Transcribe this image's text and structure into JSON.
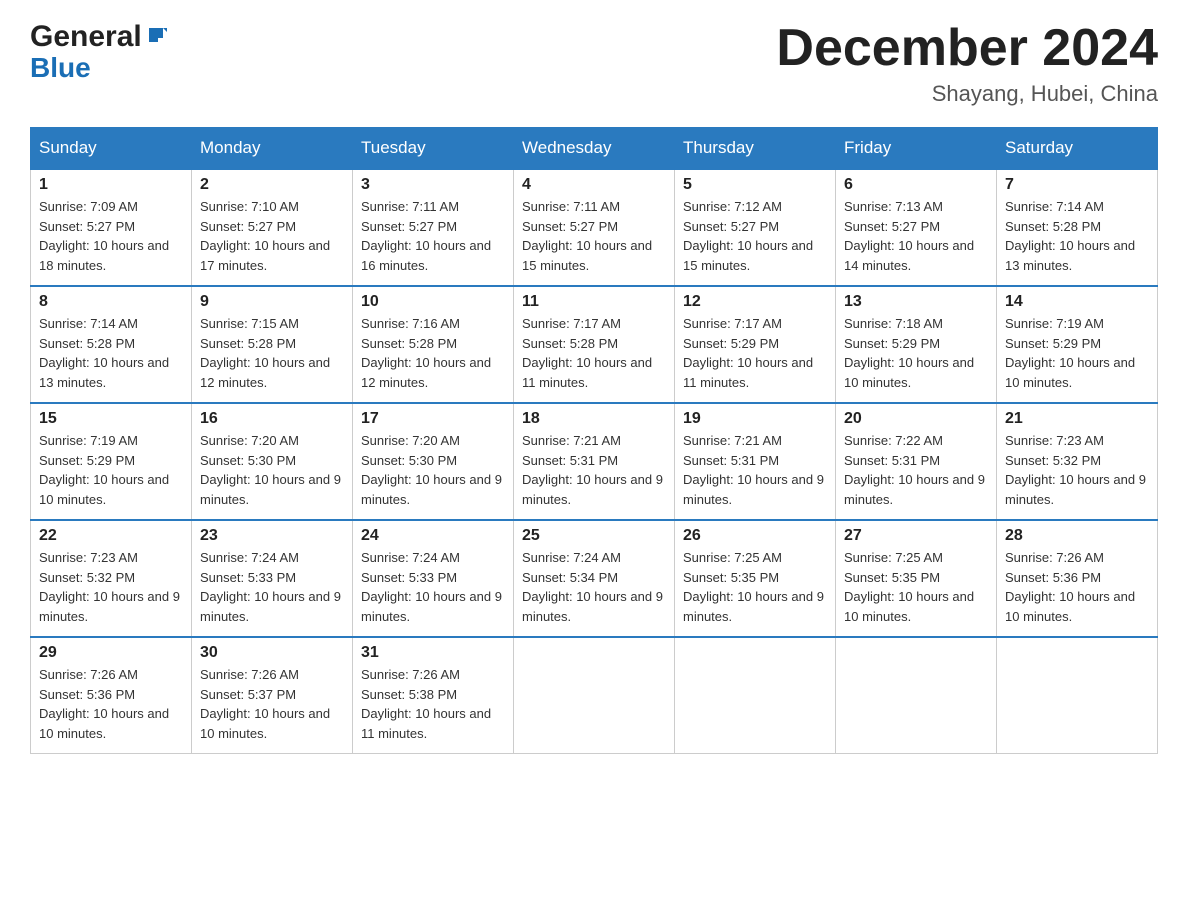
{
  "header": {
    "logo_general": "General",
    "logo_blue": "Blue",
    "month_title": "December 2024",
    "location": "Shayang, Hubei, China"
  },
  "days_of_week": [
    "Sunday",
    "Monday",
    "Tuesday",
    "Wednesday",
    "Thursday",
    "Friday",
    "Saturday"
  ],
  "weeks": [
    [
      {
        "day": "1",
        "sunrise": "7:09 AM",
        "sunset": "5:27 PM",
        "daylight": "10 hours and 18 minutes."
      },
      {
        "day": "2",
        "sunrise": "7:10 AM",
        "sunset": "5:27 PM",
        "daylight": "10 hours and 17 minutes."
      },
      {
        "day": "3",
        "sunrise": "7:11 AM",
        "sunset": "5:27 PM",
        "daylight": "10 hours and 16 minutes."
      },
      {
        "day": "4",
        "sunrise": "7:11 AM",
        "sunset": "5:27 PM",
        "daylight": "10 hours and 15 minutes."
      },
      {
        "day": "5",
        "sunrise": "7:12 AM",
        "sunset": "5:27 PM",
        "daylight": "10 hours and 15 minutes."
      },
      {
        "day": "6",
        "sunrise": "7:13 AM",
        "sunset": "5:27 PM",
        "daylight": "10 hours and 14 minutes."
      },
      {
        "day": "7",
        "sunrise": "7:14 AM",
        "sunset": "5:28 PM",
        "daylight": "10 hours and 13 minutes."
      }
    ],
    [
      {
        "day": "8",
        "sunrise": "7:14 AM",
        "sunset": "5:28 PM",
        "daylight": "10 hours and 13 minutes."
      },
      {
        "day": "9",
        "sunrise": "7:15 AM",
        "sunset": "5:28 PM",
        "daylight": "10 hours and 12 minutes."
      },
      {
        "day": "10",
        "sunrise": "7:16 AM",
        "sunset": "5:28 PM",
        "daylight": "10 hours and 12 minutes."
      },
      {
        "day": "11",
        "sunrise": "7:17 AM",
        "sunset": "5:28 PM",
        "daylight": "10 hours and 11 minutes."
      },
      {
        "day": "12",
        "sunrise": "7:17 AM",
        "sunset": "5:29 PM",
        "daylight": "10 hours and 11 minutes."
      },
      {
        "day": "13",
        "sunrise": "7:18 AM",
        "sunset": "5:29 PM",
        "daylight": "10 hours and 10 minutes."
      },
      {
        "day": "14",
        "sunrise": "7:19 AM",
        "sunset": "5:29 PM",
        "daylight": "10 hours and 10 minutes."
      }
    ],
    [
      {
        "day": "15",
        "sunrise": "7:19 AM",
        "sunset": "5:29 PM",
        "daylight": "10 hours and 10 minutes."
      },
      {
        "day": "16",
        "sunrise": "7:20 AM",
        "sunset": "5:30 PM",
        "daylight": "10 hours and 9 minutes."
      },
      {
        "day": "17",
        "sunrise": "7:20 AM",
        "sunset": "5:30 PM",
        "daylight": "10 hours and 9 minutes."
      },
      {
        "day": "18",
        "sunrise": "7:21 AM",
        "sunset": "5:31 PM",
        "daylight": "10 hours and 9 minutes."
      },
      {
        "day": "19",
        "sunrise": "7:21 AM",
        "sunset": "5:31 PM",
        "daylight": "10 hours and 9 minutes."
      },
      {
        "day": "20",
        "sunrise": "7:22 AM",
        "sunset": "5:31 PM",
        "daylight": "10 hours and 9 minutes."
      },
      {
        "day": "21",
        "sunrise": "7:23 AM",
        "sunset": "5:32 PM",
        "daylight": "10 hours and 9 minutes."
      }
    ],
    [
      {
        "day": "22",
        "sunrise": "7:23 AM",
        "sunset": "5:32 PM",
        "daylight": "10 hours and 9 minutes."
      },
      {
        "day": "23",
        "sunrise": "7:24 AM",
        "sunset": "5:33 PM",
        "daylight": "10 hours and 9 minutes."
      },
      {
        "day": "24",
        "sunrise": "7:24 AM",
        "sunset": "5:33 PM",
        "daylight": "10 hours and 9 minutes."
      },
      {
        "day": "25",
        "sunrise": "7:24 AM",
        "sunset": "5:34 PM",
        "daylight": "10 hours and 9 minutes."
      },
      {
        "day": "26",
        "sunrise": "7:25 AM",
        "sunset": "5:35 PM",
        "daylight": "10 hours and 9 minutes."
      },
      {
        "day": "27",
        "sunrise": "7:25 AM",
        "sunset": "5:35 PM",
        "daylight": "10 hours and 10 minutes."
      },
      {
        "day": "28",
        "sunrise": "7:26 AM",
        "sunset": "5:36 PM",
        "daylight": "10 hours and 10 minutes."
      }
    ],
    [
      {
        "day": "29",
        "sunrise": "7:26 AM",
        "sunset": "5:36 PM",
        "daylight": "10 hours and 10 minutes."
      },
      {
        "day": "30",
        "sunrise": "7:26 AM",
        "sunset": "5:37 PM",
        "daylight": "10 hours and 10 minutes."
      },
      {
        "day": "31",
        "sunrise": "7:26 AM",
        "sunset": "5:38 PM",
        "daylight": "10 hours and 11 minutes."
      },
      null,
      null,
      null,
      null
    ]
  ]
}
